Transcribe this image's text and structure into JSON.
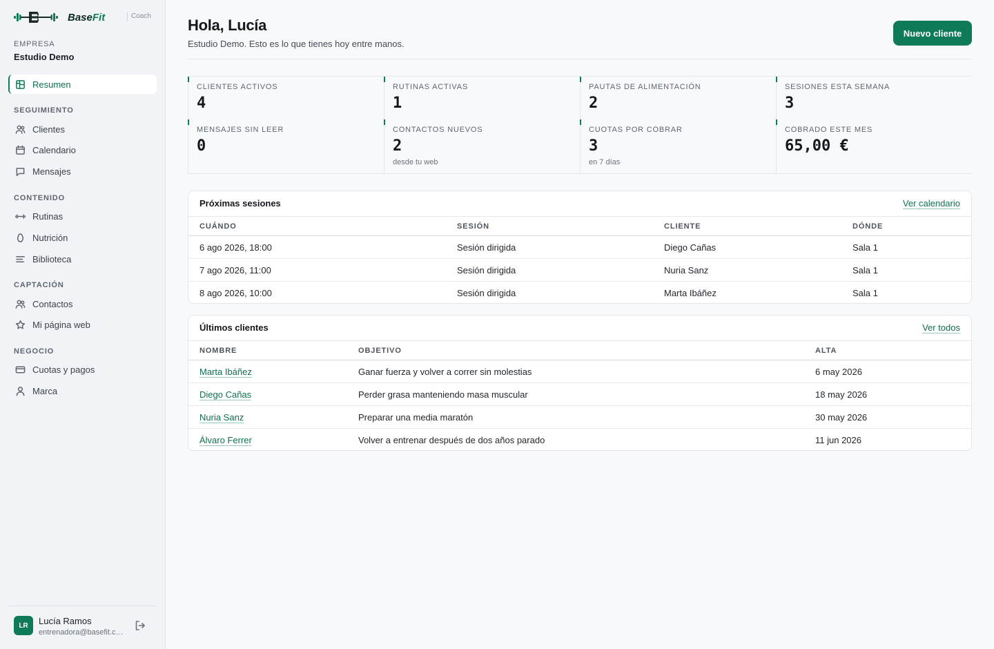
{
  "brand": {
    "name_a": "Base",
    "name_b": "Fit",
    "tag": "Coach",
    "accent": "#0f7a5a"
  },
  "company": {
    "label": "EMPRESA",
    "name": "Estudio Demo"
  },
  "nav": {
    "summary": {
      "label": "Resumen",
      "icon": "dashboard-icon"
    },
    "sections": [
      {
        "title": "SEGUIMIENTO",
        "items": [
          {
            "label": "Clientes",
            "icon": "users-icon"
          },
          {
            "label": "Calendario",
            "icon": "calendar-icon"
          },
          {
            "label": "Mensajes",
            "icon": "message-icon"
          }
        ]
      },
      {
        "title": "CONTENIDO",
        "items": [
          {
            "label": "Rutinas",
            "icon": "dumbbell-icon"
          },
          {
            "label": "Nutrición",
            "icon": "egg-icon"
          },
          {
            "label": "Biblioteca",
            "icon": "list-icon"
          }
        ]
      },
      {
        "title": "CAPTACIÓN",
        "items": [
          {
            "label": "Contactos",
            "icon": "users-icon"
          },
          {
            "label": "Mi página web",
            "icon": "star-icon"
          }
        ]
      },
      {
        "title": "NEGOCIO",
        "items": [
          {
            "label": "Cuotas y pagos",
            "icon": "card-icon"
          },
          {
            "label": "Marca",
            "icon": "person-icon"
          }
        ]
      }
    ]
  },
  "user": {
    "initials": "LR",
    "name": "Lucía Ramos",
    "email": "entrenadora@basefit.com"
  },
  "header": {
    "title": "Hola, Lucía",
    "subtitle": "Estudio Demo. Esto es lo que tienes hoy entre manos.",
    "primary_action": "Nuevo cliente"
  },
  "stats": [
    {
      "label": "CLIENTES ACTIVOS",
      "value": "4",
      "note": ""
    },
    {
      "label": "RUTINAS ACTIVAS",
      "value": "1",
      "note": ""
    },
    {
      "label": "PAUTAS DE ALIMENTACIÓN",
      "value": "2",
      "note": ""
    },
    {
      "label": "SESIONES ESTA SEMANA",
      "value": "3",
      "note": ""
    },
    {
      "label": "MENSAJES SIN LEER",
      "value": "0",
      "note": ""
    },
    {
      "label": "CONTACTOS NUEVOS",
      "value": "2",
      "note": "desde tu web"
    },
    {
      "label": "CUOTAS POR COBRAR",
      "value": "3",
      "note": "en 7 días"
    },
    {
      "label": "COBRADO ESTE MES",
      "value": "65,00 €",
      "note": ""
    }
  ],
  "sessions": {
    "title": "Próximas sesiones",
    "link": "Ver calendario",
    "columns": [
      "CUÁNDO",
      "SESIÓN",
      "CLIENTE",
      "DÓNDE"
    ],
    "rows": [
      [
        "6 ago 2026, 18:00",
        "Sesión dirigida",
        "Diego Cañas",
        "Sala 1"
      ],
      [
        "7 ago 2026, 11:00",
        "Sesión dirigida",
        "Nuria Sanz",
        "Sala 1"
      ],
      [
        "8 ago 2026, 10:00",
        "Sesión dirigida",
        "Marta Ibáñez",
        "Sala 1"
      ]
    ]
  },
  "clients": {
    "title": "Últimos clientes",
    "link": "Ver todos",
    "columns": [
      "NOMBRE",
      "OBJETIVO",
      "ALTA"
    ],
    "rows": [
      [
        "Marta Ibáñez",
        "Ganar fuerza y volver a correr sin molestias",
        "6 may 2026"
      ],
      [
        "Diego Cañas",
        "Perder grasa manteniendo masa muscular",
        "18 may 2026"
      ],
      [
        "Nuria Sanz",
        "Preparar una media maratón",
        "30 may 2026"
      ],
      [
        "Álvaro Ferrer",
        "Volver a entrenar después de dos años parado",
        "11 jun 2026"
      ]
    ]
  }
}
